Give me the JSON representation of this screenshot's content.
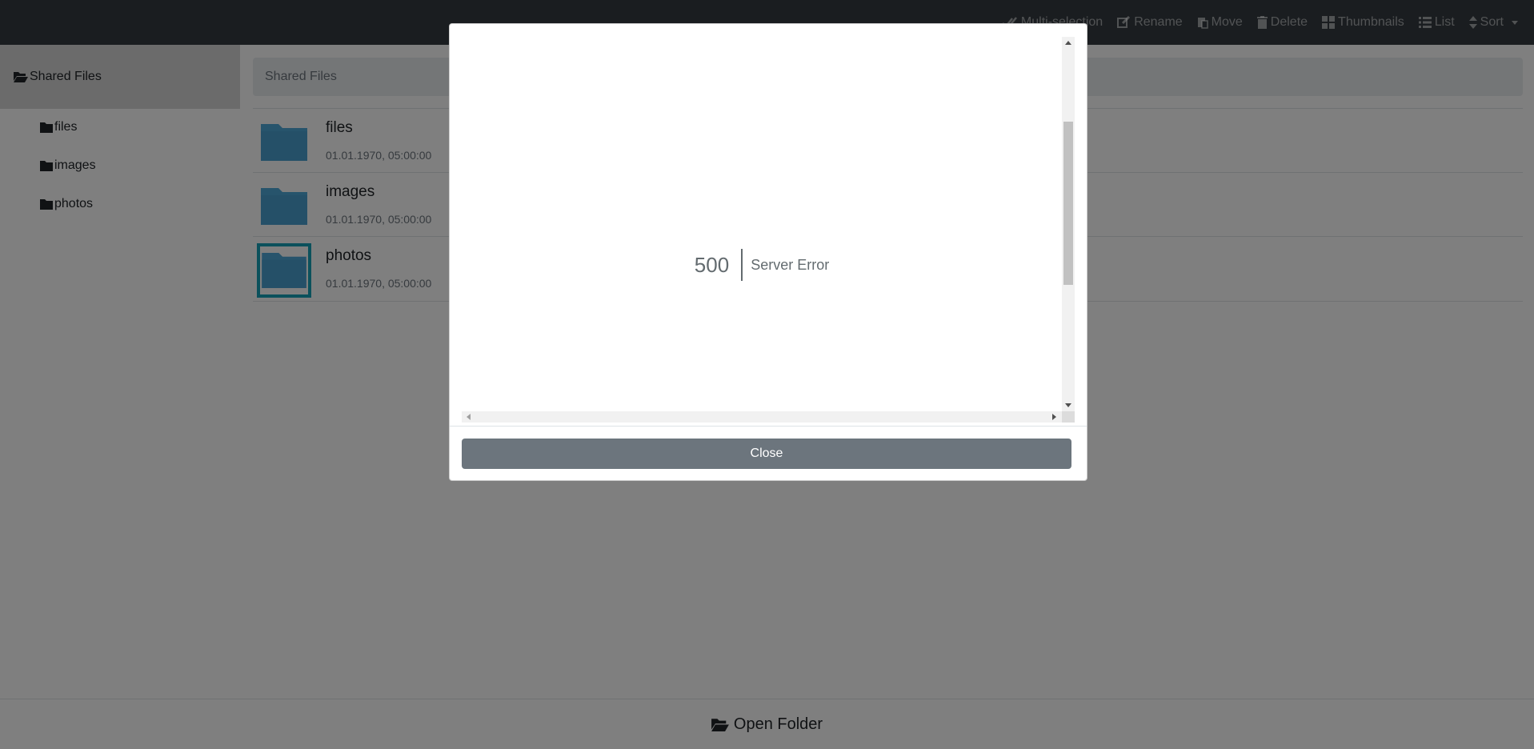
{
  "navbar": {
    "actions": [
      {
        "label": "Multi-selection",
        "icon": "check-double-icon"
      },
      {
        "label": "Rename",
        "icon": "edit-icon"
      },
      {
        "label": "Move",
        "icon": "paste-icon"
      },
      {
        "label": "Delete",
        "icon": "trash-icon"
      },
      {
        "label": "Thumbnails",
        "icon": "th-large-icon"
      },
      {
        "label": "List",
        "icon": "list-icon"
      },
      {
        "label": "Sort",
        "icon": "sort-icon"
      }
    ]
  },
  "sidebar": {
    "root": {
      "label": "Shared Files",
      "icon": "folder-open-icon"
    },
    "items": [
      {
        "label": "files",
        "icon": "folder-icon"
      },
      {
        "label": "images",
        "icon": "folder-icon"
      },
      {
        "label": "photos",
        "icon": "folder-icon"
      }
    ]
  },
  "breadcrumb": {
    "label": "Shared Files"
  },
  "files": [
    {
      "name": "files",
      "date": "01.01.1970, 05:00:00",
      "selected": false
    },
    {
      "name": "images",
      "date": "01.01.1970, 05:00:00",
      "selected": false
    },
    {
      "name": "photos",
      "date": "01.01.1970, 05:00:00",
      "selected": true
    }
  ],
  "footer": {
    "open_folder_label": "Open Folder",
    "icon": "folder-open-icon"
  },
  "modal": {
    "error_code": "500",
    "error_message": "Server Error",
    "close_label": "Close"
  },
  "colors": {
    "navbar": "#343a40",
    "folder": "#4fa8d8",
    "selected_border": "#17a2b8",
    "close_button": "#6c757d"
  }
}
